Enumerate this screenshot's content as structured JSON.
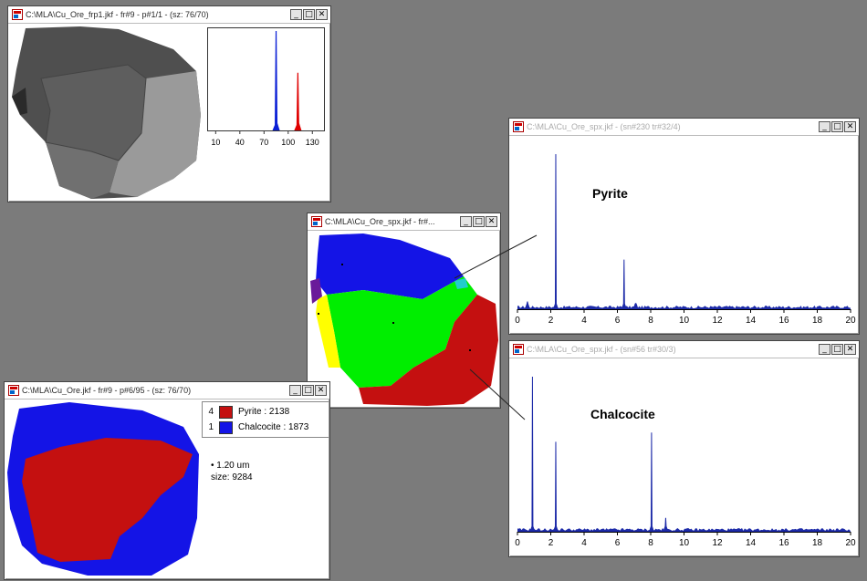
{
  "windows": {
    "topleft": {
      "title": "C:\\MLA\\Cu_Ore_frp1.jkf - fr#9 - p#1/1 - (sz: 76/70)",
      "histogram": {
        "ticks": [
          "10",
          "40",
          "70",
          "100",
          "130"
        ],
        "peaks": [
          {
            "name": "blue",
            "color": "#0a1fd6",
            "x": 85,
            "height": 1.0
          },
          {
            "name": "red",
            "color": "#e00000",
            "x": 112,
            "height": 0.58
          }
        ],
        "x_range": [
          0,
          145
        ]
      }
    },
    "middle": {
      "title": "C:\\MLA\\Cu_Ore_spx.jkf - fr#..."
    },
    "pyrite_spectrum": {
      "title": "C:\\MLA\\Cu_Ore_spx.jkf - (sn#230 tr#32/4)",
      "label": "Pyrite",
      "ticks": [
        "0",
        "2",
        "4",
        "6",
        "8",
        "10",
        "12",
        "14",
        "16",
        "18",
        "20"
      ],
      "peaks": [
        {
          "x": 0.6,
          "h": 0.05
        },
        {
          "x": 2.3,
          "h": 1.0
        },
        {
          "x": 6.4,
          "h": 0.32
        },
        {
          "x": 7.1,
          "h": 0.04
        }
      ]
    },
    "chalcocite_spectrum": {
      "title": "C:\\MLA\\Cu_Ore_spx.jkf - (sn#56 tr#30/3)",
      "label": "Chalcocite",
      "ticks": [
        "0",
        "2",
        "4",
        "6",
        "8",
        "10",
        "12",
        "14",
        "16",
        "18",
        "20"
      ],
      "peaks": [
        {
          "x": 0.9,
          "h": 1.0
        },
        {
          "x": 2.3,
          "h": 0.58
        },
        {
          "x": 8.05,
          "h": 0.64
        },
        {
          "x": 8.9,
          "h": 0.09
        }
      ]
    },
    "bottomleft": {
      "title": "C:\\MLA\\Cu_Ore.jkf - fr#9 - p#6/95 - (sz: 76/70)",
      "legend": [
        {
          "count": "4",
          "label": "Pyrite : 2138",
          "color": "#c41010"
        },
        {
          "count": "1",
          "label": "Chalcocite : 1873",
          "color": "#1414e6"
        }
      ],
      "info": {
        "scale": "1.20 um",
        "size": "size: 9284"
      }
    }
  },
  "buttons": {
    "minimize": "_",
    "maximize": "□",
    "close": "✕"
  },
  "colors": {
    "blue_mineral": "#1414e6",
    "red_mineral": "#c41010",
    "green_mineral": "#00ee00",
    "yellow_mineral": "#ffff00",
    "spectrum": "#1c2aa8",
    "desktop": "#7b7b7b"
  }
}
